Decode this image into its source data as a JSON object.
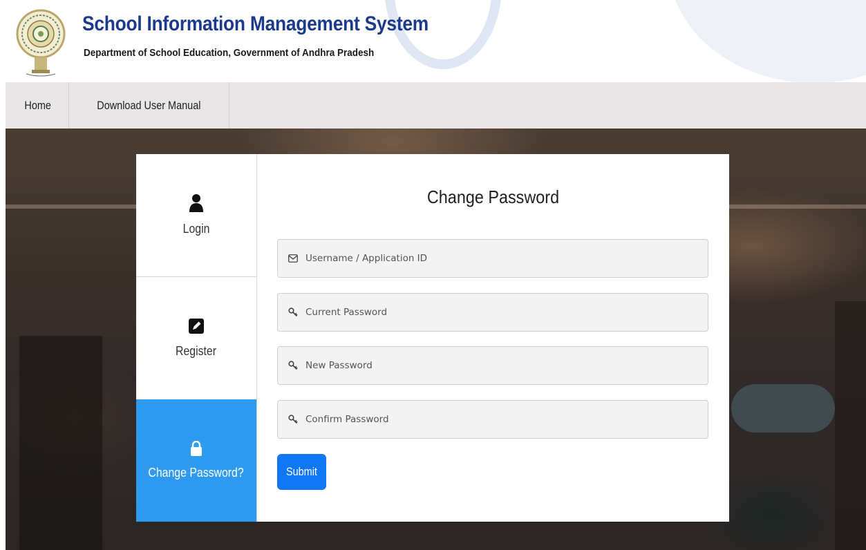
{
  "header": {
    "title": "School Information Management System",
    "subtitle": "Department of School Education, Government of Andhra Pradesh",
    "logo_icon": "andhra-pradesh-emblem"
  },
  "nav": {
    "items": [
      {
        "label": "Home"
      },
      {
        "label": "Download User Manual"
      }
    ]
  },
  "tabs": [
    {
      "label": "Login",
      "icon": "user-icon"
    },
    {
      "label": "Register",
      "icon": "edit-icon"
    },
    {
      "label": "Change Password?",
      "icon": "lock-icon",
      "active": true
    }
  ],
  "form": {
    "title": "Change Password",
    "fields": [
      {
        "placeholder": "Username / Application ID",
        "value": "",
        "icon": "envelope-icon"
      },
      {
        "placeholder": "Current Password",
        "value": "",
        "icon": "key-icon"
      },
      {
        "placeholder": "New Password",
        "value": "",
        "icon": "key-icon"
      },
      {
        "placeholder": "Confirm Password",
        "value": "",
        "icon": "key-icon"
      }
    ],
    "submit_label": "Submit"
  },
  "colors": {
    "title": "#1c3a8c",
    "active_tab": "#2e9bf0",
    "submit": "#1177f5",
    "nav_bg": "#e8e6e6"
  }
}
